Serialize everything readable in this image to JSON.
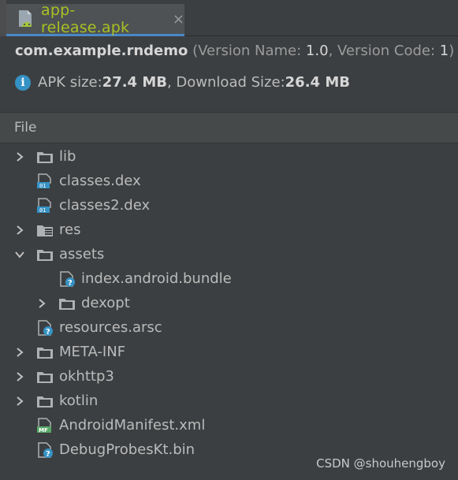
{
  "tab": {
    "label": "app-release.apk",
    "close": "×"
  },
  "header": {
    "package": "com.example.rndemo",
    "version_open": "(Version Name: ",
    "version_name": "1.0",
    "version_mid": ", Version Code: ",
    "version_code": "1",
    "version_close": ")",
    "apk_size_label": "APK size: ",
    "apk_size_value": "27.4 MB",
    "download_size_label": ", Download Size: ",
    "download_size_value": "26.4 MB"
  },
  "column_header": "File",
  "tree": [
    {
      "label": "lib",
      "icon": "folder-icon",
      "chevron": "collapsed",
      "depth": 0
    },
    {
      "label": "classes.dex",
      "icon": "dex-file-icon",
      "chevron": "none",
      "depth": 0
    },
    {
      "label": "classes2.dex",
      "icon": "dex-file-icon",
      "chevron": "none",
      "depth": 0
    },
    {
      "label": "res",
      "icon": "resource-folder-icon",
      "chevron": "collapsed",
      "depth": 0
    },
    {
      "label": "assets",
      "icon": "folder-icon",
      "chevron": "expanded",
      "depth": 0
    },
    {
      "label": "index.android.bundle",
      "icon": "unknown-file-icon",
      "chevron": "none",
      "depth": 1
    },
    {
      "label": "dexopt",
      "icon": "folder-icon",
      "chevron": "collapsed",
      "depth": 1
    },
    {
      "label": "resources.arsc",
      "icon": "unknown-file-icon",
      "chevron": "none",
      "depth": 0
    },
    {
      "label": "META-INF",
      "icon": "folder-icon",
      "chevron": "collapsed",
      "depth": 0
    },
    {
      "label": "okhttp3",
      "icon": "folder-icon",
      "chevron": "collapsed",
      "depth": 0
    },
    {
      "label": "kotlin",
      "icon": "folder-icon",
      "chevron": "collapsed",
      "depth": 0
    },
    {
      "label": "AndroidManifest.xml",
      "icon": "manifest-file-icon",
      "chevron": "none",
      "depth": 0
    },
    {
      "label": "DebugProbesKt.bin",
      "icon": "unknown-file-icon",
      "chevron": "none",
      "depth": 0
    }
  ],
  "watermark": "CSDN @shouhengboy",
  "colors": {
    "tab_label": "#a8c023",
    "selected_underline": "#4a88c7",
    "info": "#3592c4"
  }
}
